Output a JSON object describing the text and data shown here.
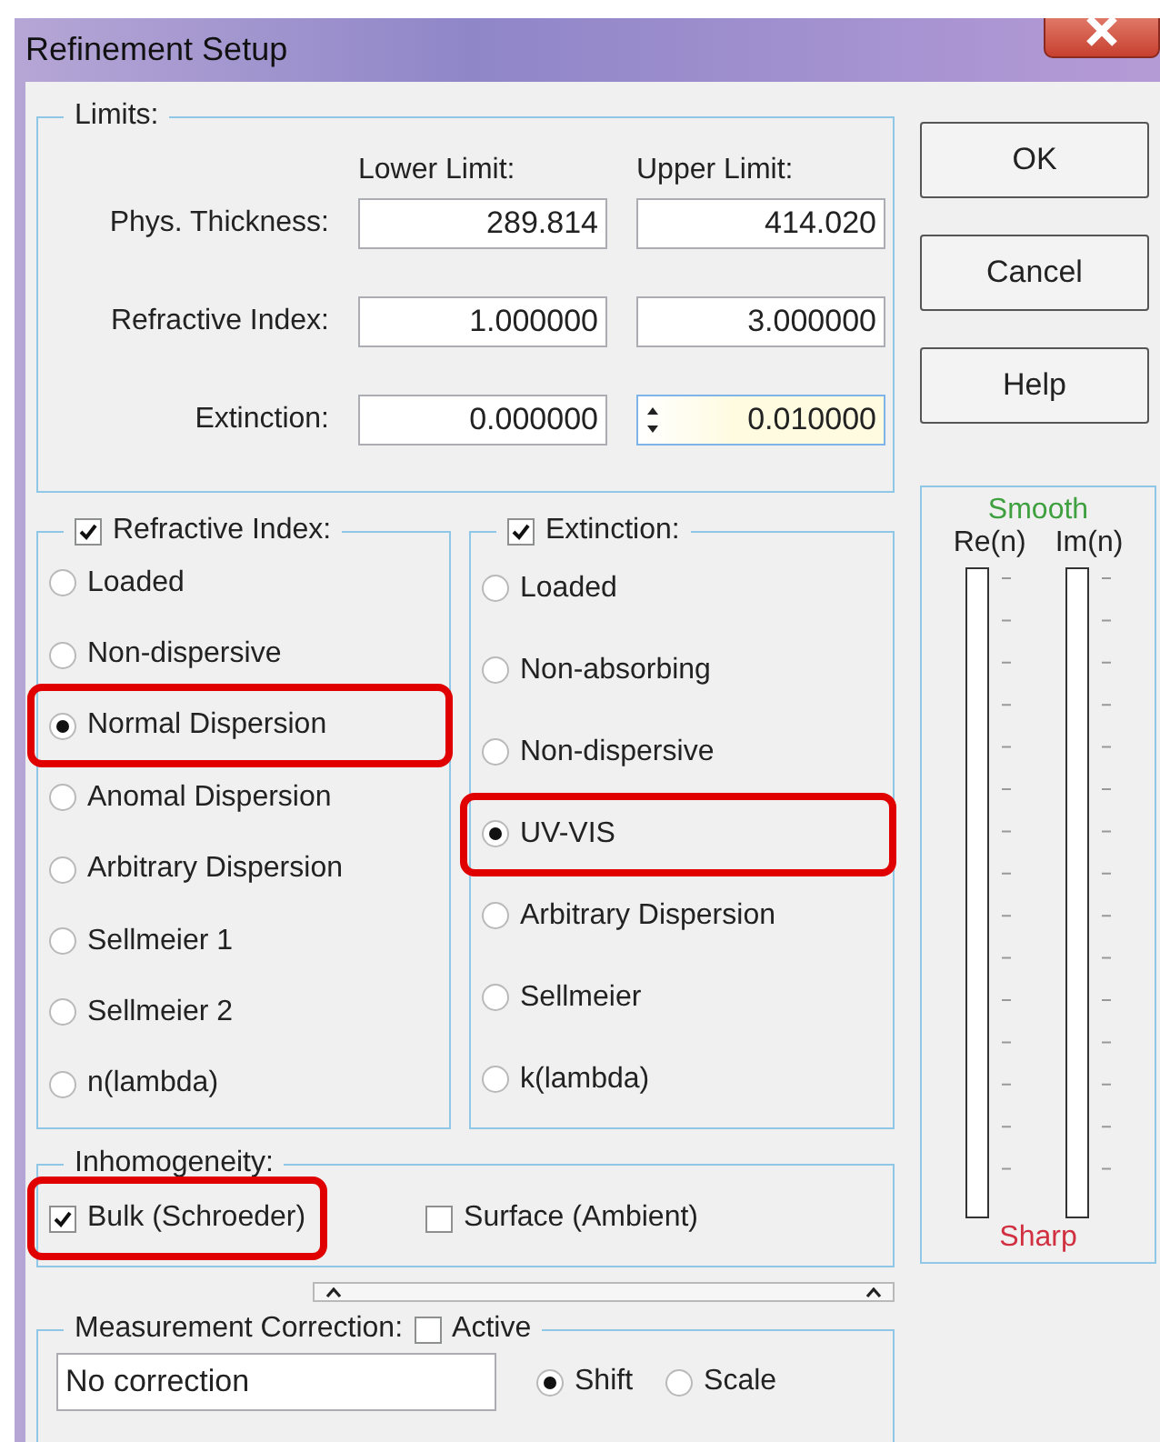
{
  "window": {
    "title": "Refinement Setup"
  },
  "limits": {
    "title": "Limits:",
    "column_headers": [
      "Lower Limit:",
      "Upper Limit:"
    ],
    "rows": [
      {
        "label": "Phys. Thickness:",
        "lower": "289.814",
        "upper": "414.020",
        "spinner": false,
        "focused": false
      },
      {
        "label": "Refractive Index:",
        "lower": "1.000000",
        "upper": "3.000000",
        "spinner": false,
        "focused": false
      },
      {
        "label": "Extinction:",
        "lower": "0.000000",
        "upper": "0.010000",
        "spinner": true,
        "focused": true
      }
    ]
  },
  "refractive_index": {
    "title": "Refractive Index:",
    "checked": true,
    "options": [
      {
        "label": "Loaded",
        "selected": false,
        "highlighted": false
      },
      {
        "label": "Non-dispersive",
        "selected": false,
        "highlighted": false
      },
      {
        "label": "Normal Dispersion",
        "selected": true,
        "highlighted": true
      },
      {
        "label": "Anomal Dispersion",
        "selected": false,
        "highlighted": false
      },
      {
        "label": "Arbitrary Dispersion",
        "selected": false,
        "highlighted": false
      },
      {
        "label": "Sellmeier 1",
        "selected": false,
        "highlighted": false
      },
      {
        "label": "Sellmeier 2",
        "selected": false,
        "highlighted": false
      },
      {
        "label": "n(lambda)",
        "selected": false,
        "highlighted": false
      }
    ]
  },
  "extinction": {
    "title": "Extinction:",
    "checked": true,
    "options": [
      {
        "label": "Loaded",
        "selected": false,
        "highlighted": false
      },
      {
        "label": "Non-absorbing",
        "selected": false,
        "highlighted": false
      },
      {
        "label": "Non-dispersive",
        "selected": false,
        "highlighted": false
      },
      {
        "label": "UV-VIS",
        "selected": true,
        "highlighted": true
      },
      {
        "label": "Arbitrary Dispersion",
        "selected": false,
        "highlighted": false
      },
      {
        "label": "Sellmeier",
        "selected": false,
        "highlighted": false
      },
      {
        "label": "k(lambda)",
        "selected": false,
        "highlighted": false
      }
    ]
  },
  "inhomogeneity": {
    "title": "Inhomogeneity:",
    "options": [
      {
        "label": "Bulk (Schroeder)",
        "checked": true,
        "highlighted": true
      },
      {
        "label": "Surface (Ambient)",
        "checked": false,
        "highlighted": false
      }
    ]
  },
  "measurement_correction": {
    "title": "Measurement Correction:",
    "active": {
      "label": "Active",
      "checked": false
    },
    "value": "No correction",
    "modes": [
      {
        "label": "Shift",
        "selected": true
      },
      {
        "label": "Scale",
        "selected": false
      }
    ]
  },
  "buttons": [
    "OK",
    "Cancel",
    "Help"
  ],
  "smoothing": {
    "top_label": "Smooth",
    "bottom_label": "Sharp",
    "sliders": [
      {
        "label": "Re(n)"
      },
      {
        "label": "Im(n)"
      }
    ]
  }
}
